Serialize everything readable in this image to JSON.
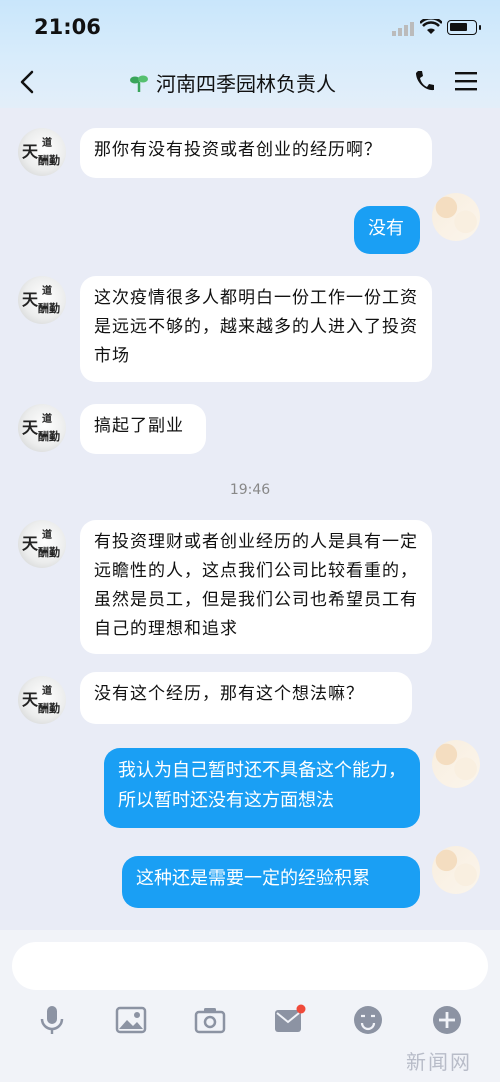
{
  "status": {
    "time": "21:06"
  },
  "header": {
    "title": "河南四季园林负责人"
  },
  "messages": {
    "m1": "那你有没有投资或者创业的经历啊？",
    "m2": "没有",
    "m3": "这次疫情很多人都明白一份工作一份工资是远远不够的，越来越多的人进入了投资市场",
    "m4": "搞起了副业",
    "ts": "19:46",
    "m5": "有投资理财或者创业经历的人是具有一定远瞻性的人，这点我们公司比较看重的，虽然是员工，但是我们公司也希望员工有自己的理想和追求",
    "m6": "没有这个经历，那有这个想法嘛？",
    "m7": "我认为自己暂时还不具备这个能力，所以暂时还没有这方面想法",
    "m8": "这种还是需要一定的经验积累"
  },
  "avatar_text": {
    "a": "天",
    "b": "道",
    "c": "酬勤"
  },
  "watermark": "新闻网",
  "colors": {
    "accent": "#1a9ff4",
    "bg": "#e9ecf6"
  },
  "toolbar": [
    "mic-icon",
    "image-icon",
    "camera-icon",
    "envelope-icon",
    "emoji-icon",
    "plus-icon"
  ]
}
